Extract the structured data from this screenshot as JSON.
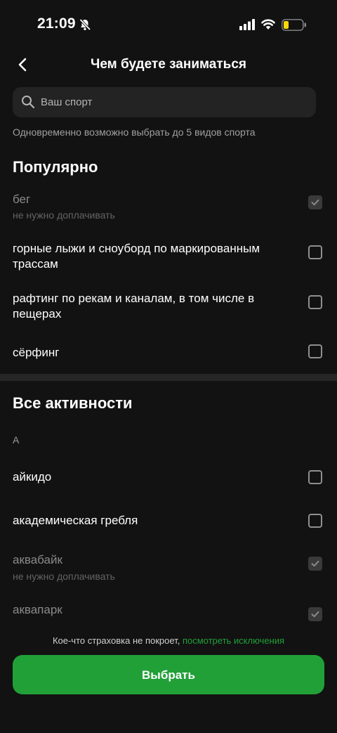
{
  "status_bar": {
    "time": "21:09",
    "icons": [
      "bell-slash-icon",
      "signal-icon",
      "wifi-icon",
      "battery-low-icon"
    ]
  },
  "header": {
    "title": "Чем будете заниматься",
    "back_icon": "chevron-left-icon"
  },
  "search": {
    "placeholder": "Ваш спорт",
    "value": ""
  },
  "hint": "Одновременно возможно выбрать до 5 видов спорта",
  "popular": {
    "title": "Популярно",
    "items": [
      {
        "label": "бег",
        "sub": "не нужно доплачивать",
        "checked": true,
        "disabled": true
      },
      {
        "label": "горные лыжи и сноуборд по маркированным трассам",
        "checked": false
      },
      {
        "label": "рафтинг по рекам и каналам, в том числе в пещерах",
        "checked": false
      },
      {
        "label": "сёрфинг",
        "checked": false
      }
    ]
  },
  "all": {
    "title": "Все активности",
    "letter": "А",
    "items": [
      {
        "label": "айкидо",
        "checked": false
      },
      {
        "label": "академическая гребля",
        "checked": false
      },
      {
        "label": "аквабайк",
        "sub": "не нужно доплачивать",
        "checked": true,
        "disabled": true
      },
      {
        "label": "аквапарк",
        "checked": true,
        "disabled": true
      }
    ]
  },
  "footer": {
    "disclaimer_text": "Кое-что страховка не покроет,",
    "disclaimer_link": "посмотреть исключения",
    "button": "Выбрать"
  },
  "colors": {
    "accent": "#21a038",
    "background": "#121212",
    "surface": "#232323"
  }
}
